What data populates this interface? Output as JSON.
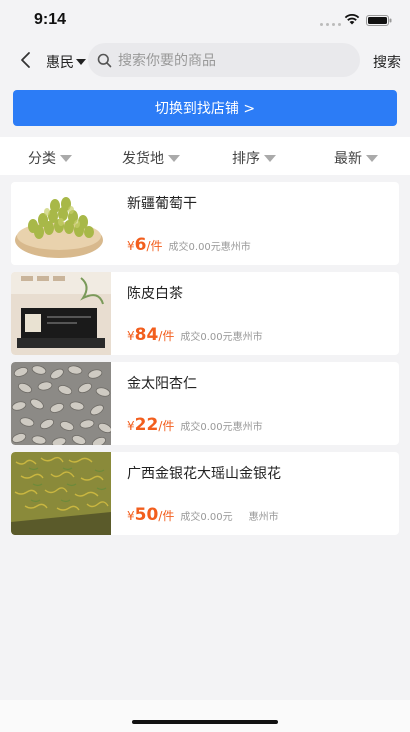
{
  "status": {
    "time": "9:14"
  },
  "header": {
    "city": "惠民",
    "search_placeholder": "搜索你要的商品",
    "search_label": "搜索"
  },
  "switch_button": "切换到找店铺 >",
  "filters": [
    {
      "label": "分类"
    },
    {
      "label": "发货地"
    },
    {
      "label": "排序"
    },
    {
      "label": "最新"
    }
  ],
  "products": [
    {
      "name": "新疆葡萄干",
      "currency": "¥",
      "price": "6",
      "unit": "/件",
      "sold": "成交0.00元",
      "location": "惠州市"
    },
    {
      "name": "陈皮白茶",
      "currency": "¥",
      "price": "84",
      "unit": "/件",
      "sold": "成交0.00元",
      "location": "惠州市"
    },
    {
      "name": "金太阳杏仁",
      "currency": "¥",
      "price": "22",
      "unit": "/件",
      "sold": "成交0.00元",
      "location": "惠州市"
    },
    {
      "name": "广西金银花大瑶山金银花",
      "currency": "¥",
      "price": "50",
      "unit": "/件",
      "sold": "成交0.00元",
      "location": "惠州市"
    }
  ],
  "icons": {
    "back": "chevron-left-icon",
    "search": "search-icon",
    "dropdown": "triangle-down-icon"
  },
  "colors": {
    "accent": "#2c7cf6",
    "price": "#f25e1d"
  }
}
